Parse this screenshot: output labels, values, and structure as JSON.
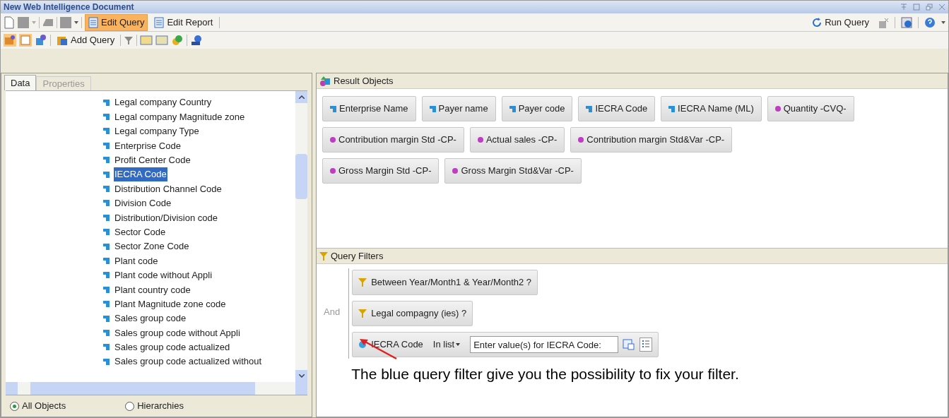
{
  "window": {
    "title": "New Web Intelligence Document"
  },
  "toolbar": {
    "edit_query": {
      "label": "Edit Query",
      "selected": true
    },
    "edit_report": {
      "label": "Edit Report",
      "selected": false
    },
    "run_query": "Run Query",
    "add_query": "Add Query"
  },
  "left_panel": {
    "tabs": [
      {
        "label": "Data",
        "selected": true
      },
      {
        "label": "Properties",
        "selected": false
      }
    ],
    "tree_items": [
      {
        "label": "Legal company Country",
        "selected": false
      },
      {
        "label": "Legal company Magnitude zone",
        "selected": false
      },
      {
        "label": "Legal company Type",
        "selected": false
      },
      {
        "label": "Enterprise Code",
        "selected": false
      },
      {
        "label": "Profit Center Code",
        "selected": false
      },
      {
        "label": "IECRA Code",
        "selected": true
      },
      {
        "label": "Distribution Channel Code",
        "selected": false
      },
      {
        "label": "Division Code",
        "selected": false
      },
      {
        "label": "Distribution/Division code",
        "selected": false
      },
      {
        "label": "Sector Code",
        "selected": false
      },
      {
        "label": "Sector Zone Code",
        "selected": false
      },
      {
        "label": "Plant code",
        "selected": false
      },
      {
        "label": "Plant code without Appli",
        "selected": false
      },
      {
        "label": "Plant country code",
        "selected": false
      },
      {
        "label": "Plant Magnitude zone code",
        "selected": false
      },
      {
        "label": "Sales group code",
        "selected": false
      },
      {
        "label": "Sales group code without Appli",
        "selected": false
      },
      {
        "label": "Sales group code actualized",
        "selected": false
      },
      {
        "label": "Sales group code actualized without",
        "selected": false
      }
    ],
    "view_options": [
      {
        "label": "All Objects",
        "selected": true
      },
      {
        "label": "Hierarchies",
        "selected": false
      }
    ]
  },
  "result_objects": {
    "title": "Result Objects",
    "objects": [
      {
        "label": "Enterprise Name",
        "kind": "dimension"
      },
      {
        "label": "Payer name",
        "kind": "dimension"
      },
      {
        "label": "Payer code",
        "kind": "dimension"
      },
      {
        "label": "IECRA Code",
        "kind": "dimension"
      },
      {
        "label": "IECRA Name (ML)",
        "kind": "dimension"
      },
      {
        "label": "Quantity -CVQ-",
        "kind": "measure"
      },
      {
        "label": "Contribution margin Std -CP-",
        "kind": "measure",
        "new_line": true
      },
      {
        "label": "Actual sales -CP-",
        "kind": "measure"
      },
      {
        "label": "Contribution margin Std&Var -CP-",
        "kind": "measure"
      },
      {
        "label": "Gross Margin Std -CP-",
        "kind": "measure",
        "new_line": true
      },
      {
        "label": "Gross Margin Std&Var -CP-",
        "kind": "measure"
      }
    ]
  },
  "query_filters": {
    "title": "Query Filters",
    "operator": "And",
    "filters": [
      {
        "kind": "predefined",
        "label": "Between Year/Month1 & Year/Month2 ?"
      },
      {
        "kind": "predefined",
        "label": "Legal compagny (ies) ?"
      },
      {
        "kind": "custom",
        "label": "IECRA Code",
        "condition": "In list",
        "value": "Enter value(s) for IECRA Code:"
      }
    ]
  },
  "annotation": "The blue query filter give you the possibility to fix your filter."
}
